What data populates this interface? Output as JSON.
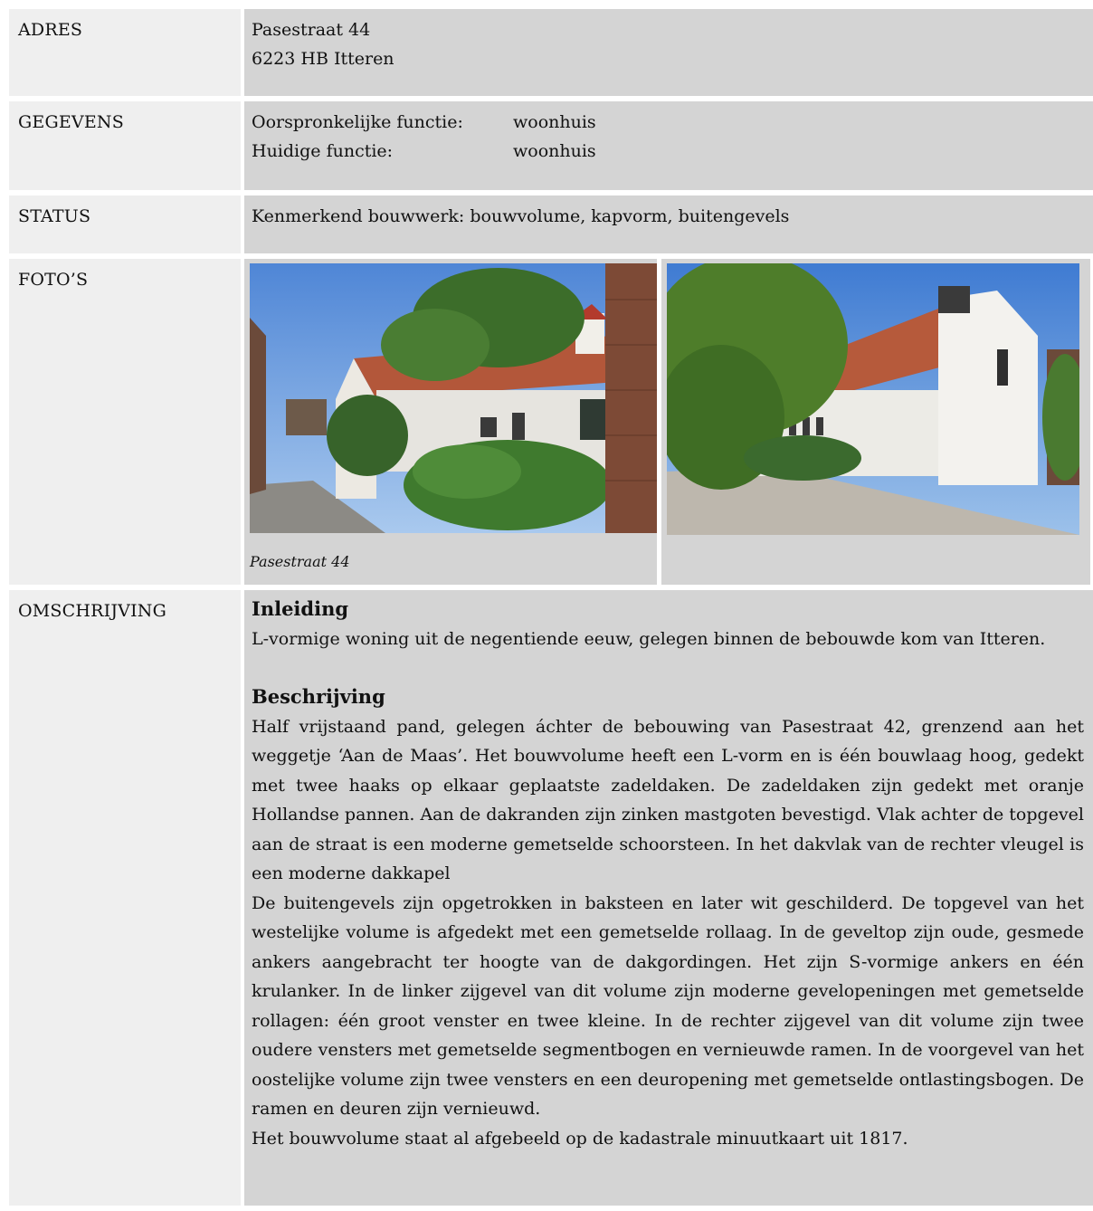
{
  "adres": {
    "label": "ADRES",
    "line1": "Pasestraat 44",
    "line2": "6223 HB Itteren"
  },
  "gegevens": {
    "label": "GEGEVENS",
    "items": [
      {
        "key": "Oorspronkelijke functie:",
        "value": "woonhuis"
      },
      {
        "key": "Huidige functie:",
        "value": "woonhuis"
      }
    ]
  },
  "status": {
    "label": "STATUS",
    "value": "Kenmerkend bouwwerk: bouwvolume, kapvorm, buitengevels"
  },
  "fotos": {
    "label": "FOTO’S",
    "caption": "Pasestraat 44"
  },
  "omschrijving": {
    "label": "OMSCHRIJVING",
    "inleiding_heading": "Inleiding",
    "inleiding_text": "L-vormige woning uit de negentiende eeuw, gelegen binnen de bebouwde kom van Itteren.",
    "beschrijving_heading": "Beschrijving",
    "paragraphs": [
      "Half vrijstaand pand, gelegen áchter de bebouwing van Pasestraat 42, grenzend aan het weggetje ‘Aan de Maas’. Het bouwvolume heeft een L-vorm en is één bouwlaag hoog, gedekt met twee haaks op elkaar geplaatste zadeldaken. De zadeldaken zijn gedekt met oranje Hollandse pannen. Aan de dakranden zijn zinken mastgoten bevestigd. Vlak achter de topgevel aan de straat is een moderne gemetselde schoorsteen. In het dakvlak van de rechter vleugel is een moderne dakkapel",
      "De buitengevels zijn opgetrokken in baksteen en later wit geschilderd. De topgevel van het westelijke volume is afgedekt met een gemetselde rollaag. In de geveltop zijn oude, gesmede ankers aangebracht ter hoogte van de dakgordingen. Het zijn S-vormige ankers en één krulanker. In de linker zijgevel van dit volume zijn moderne gevelopeningen met gemetselde rollagen: één groot venster en twee kleine. In de rechter zijgevel van dit volume zijn twee oudere vensters met gemetselde segmentbogen en vernieuwde ramen. In de voorgevel van het oostelijke volume zijn twee vensters en een deuropening met gemetselde ontlastingsbogen. De ramen en deuren zijn vernieuwd.",
      "Het bouwvolume staat al afgebeeld op de kadastrale minuutkaart uit 1817."
    ]
  }
}
